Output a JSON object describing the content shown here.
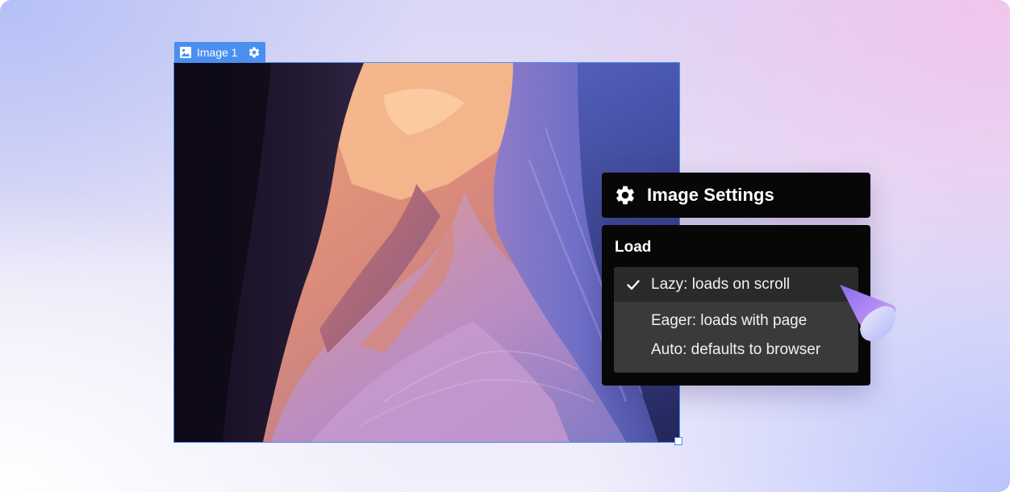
{
  "image_element": {
    "label": "Image 1",
    "icon": "image-icon",
    "settings_icon": "gear-icon"
  },
  "settings_panel": {
    "icon": "gear-icon",
    "title": "Image Settings",
    "section_title": "Load",
    "options": [
      {
        "label": "Lazy: loads on scroll",
        "selected": true
      },
      {
        "label": "Eager: loads with page",
        "selected": false
      },
      {
        "label": "Auto: defaults to browser",
        "selected": false
      }
    ]
  },
  "colors": {
    "accent": "#4a8ff0",
    "panel_bg": "#070707",
    "dropdown_bg": "#3a3a3a",
    "selected_bg": "#2a2a2a"
  }
}
